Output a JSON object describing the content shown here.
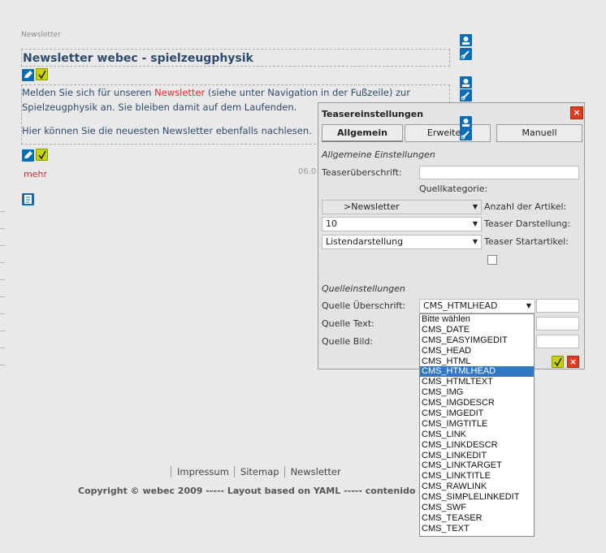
{
  "page": {
    "breadcrumb": "Newsletter",
    "title": "Newsletter webec - spielzeugphysik",
    "para1_pre": "Melden Sie sich für unseren ",
    "para1_link": "Newsletter",
    "para1_post": " (siehe unter Navigation in der Fußzeile) zur",
    "para1_line2": "Spielzeugphysik an. Sie bleiben damit auf dem Laufenden.",
    "para2": "Hier können Sie die neuesten Newsletter ebenfalls nachlesen.",
    "more_link": "mehr",
    "date": "06.0"
  },
  "footer": {
    "nav": [
      "Impressum",
      "Sitemap",
      "Newsletter"
    ],
    "copyright": "Copyright © webec 2009  -----  Layout based on YAML  -----  contenido 4.8"
  },
  "dialog": {
    "title": "Teasereinstellungen",
    "close": "×",
    "tabs": [
      "Allgemein",
      "Erweitert",
      "Manuell"
    ],
    "active_tab": "Allgemein",
    "general_section": "Allgemeine Einstellungen",
    "teaser_heading_label": "Teaserüberschrift:",
    "source_category_label": "Quellkategorie:",
    "category_value": ">Newsletter",
    "articles_count_label": "Anzahl der Artikel:",
    "articles_count_value": "10",
    "display_label": "Teaser Darstellung:",
    "display_value": "Listendarstellung",
    "start_article_label": "Teaser Startartikel:",
    "source_section": "Quelleinstellungen",
    "source_heading_label": "Quelle Überschrift:",
    "source_heading_value": "CMS_HTMLHEAD",
    "source_text_label": "Quelle Text:",
    "source_image_label": "Quelle Bild:",
    "ok": "✓",
    "cancel": "×",
    "dropdown_options": [
      "Bitte wählen",
      "CMS_DATE",
      "CMS_EASYIMGEDIT",
      "CMS_HEAD",
      "CMS_HTML",
      "CMS_HTMLHEAD",
      "CMS_HTMLTEXT",
      "CMS_IMG",
      "CMS_IMGDESCR",
      "CMS_IMGEDIT",
      "CMS_IMGTITLE",
      "CMS_LINK",
      "CMS_LINKDESCR",
      "CMS_LINKEDIT",
      "CMS_LINKTARGET",
      "CMS_LINKTITLE",
      "CMS_RAWLINK",
      "CMS_SIMPLELINKEDIT",
      "CMS_SWF",
      "CMS_TEASER",
      "CMS_TEXT"
    ],
    "dropdown_selected_index": 5
  },
  "colors": {
    "accent_blue": "#0b6cb6",
    "accent_yellow": "#c7d400",
    "close_red": "#e03a1f",
    "selected": "#3177c6"
  }
}
